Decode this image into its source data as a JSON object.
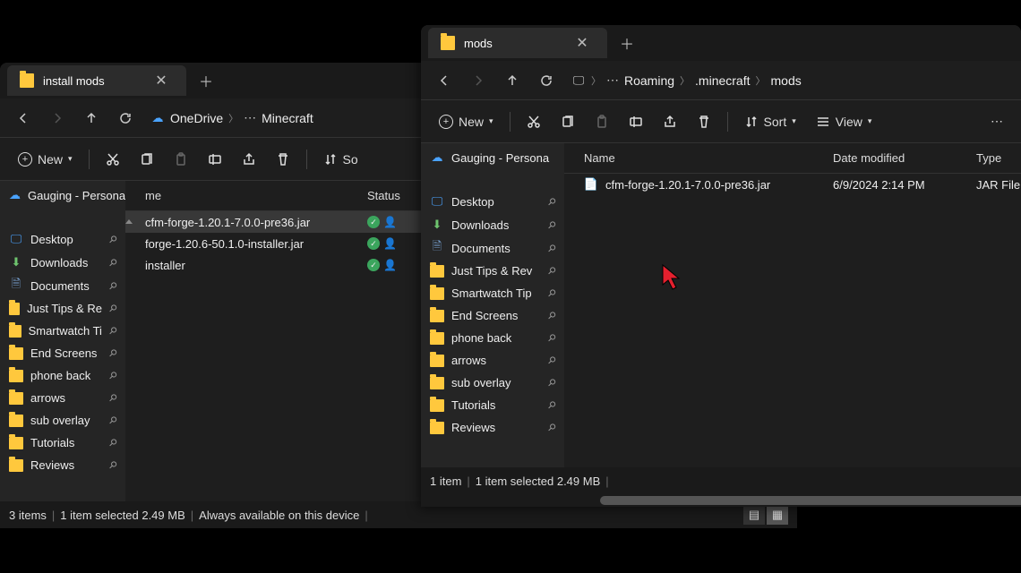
{
  "window_a": {
    "tab_title": "install mods",
    "crumbs": [
      "OneDrive",
      "Minecraft"
    ],
    "new_btn": "New",
    "sort_btn": "So",
    "side_current": "Gauging - Persona",
    "side_items": [
      {
        "label": "Desktop",
        "type": "desktop"
      },
      {
        "label": "Downloads",
        "type": "downloads"
      },
      {
        "label": "Documents",
        "type": "documents"
      },
      {
        "label": "Just Tips & Re",
        "type": "folder"
      },
      {
        "label": "Smartwatch Ti",
        "type": "folder"
      },
      {
        "label": "End Screens",
        "type": "folder"
      },
      {
        "label": "phone back",
        "type": "folder"
      },
      {
        "label": "arrows",
        "type": "folder"
      },
      {
        "label": "sub overlay",
        "type": "folder"
      },
      {
        "label": "Tutorials",
        "type": "folder"
      },
      {
        "label": "Reviews",
        "type": "folder"
      }
    ],
    "col_name": "me",
    "col_status": "Status",
    "files": [
      {
        "name": "cfm-forge-1.20.1-7.0.0-pre36.jar",
        "selected": true
      },
      {
        "name": "forge-1.20.6-50.1.0-installer.jar",
        "selected": false
      },
      {
        "name": "installer",
        "selected": false
      }
    ],
    "status": {
      "items": "3 items",
      "selected": "1 item selected  2.49 MB",
      "avail": "Always available on this device"
    }
  },
  "window_b": {
    "tab_title": "mods",
    "crumbs": [
      "Roaming",
      ".minecraft",
      "mods"
    ],
    "new_btn": "New",
    "sort_btn": "Sort",
    "view_btn": "View",
    "side_current": "Gauging - Persona",
    "side_items": [
      {
        "label": "Desktop",
        "type": "desktop"
      },
      {
        "label": "Downloads",
        "type": "downloads"
      },
      {
        "label": "Documents",
        "type": "documents"
      },
      {
        "label": "Just Tips & Rev",
        "type": "folder"
      },
      {
        "label": "Smartwatch Tip",
        "type": "folder"
      },
      {
        "label": "End Screens",
        "type": "folder"
      },
      {
        "label": "phone back",
        "type": "folder"
      },
      {
        "label": "arrows",
        "type": "folder"
      },
      {
        "label": "sub overlay",
        "type": "folder"
      },
      {
        "label": "Tutorials",
        "type": "folder"
      },
      {
        "label": "Reviews",
        "type": "folder"
      }
    ],
    "col_name": "Name",
    "col_date": "Date modified",
    "col_type": "Type",
    "files": [
      {
        "name": "cfm-forge-1.20.1-7.0.0-pre36.jar",
        "date": "6/9/2024 2:14 PM",
        "type": "JAR File"
      }
    ],
    "status": {
      "items": "1 item",
      "selected": "1 item selected  2.49 MB"
    }
  }
}
